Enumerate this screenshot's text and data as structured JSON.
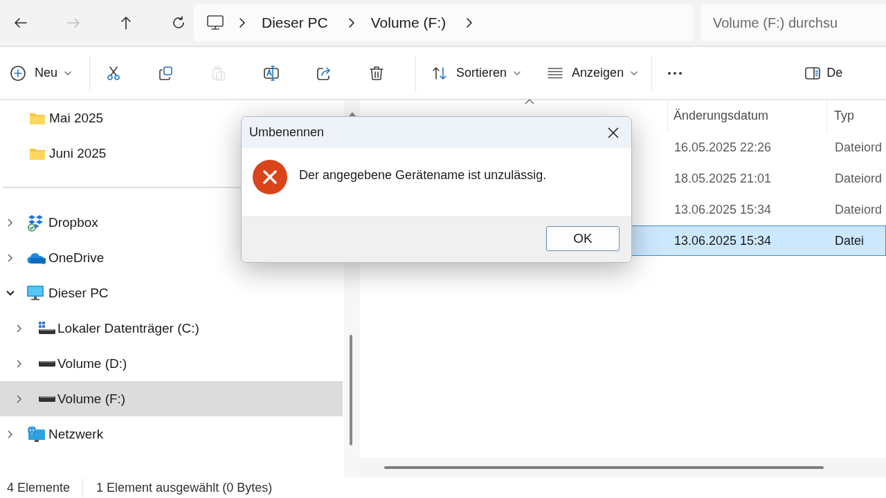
{
  "nav": [
    {
      "kind": "back",
      "disabled": false
    },
    {
      "kind": "forward",
      "disabled": true
    },
    {
      "kind": "up",
      "disabled": false
    },
    {
      "kind": "refresh",
      "disabled": false
    }
  ],
  "address": {
    "segments": [
      "Dieser PC",
      "Volume (F:)"
    ]
  },
  "search": {
    "placeholder": "Volume (F:) durchsu"
  },
  "toolbar": [
    {
      "kind": "new",
      "label": "Neu",
      "dropdown": true,
      "disabled": false
    },
    {
      "kind": "cut",
      "disabled": false
    },
    {
      "kind": "copy",
      "disabled": false
    },
    {
      "kind": "paste",
      "disabled": true
    },
    {
      "kind": "rename",
      "disabled": false
    },
    {
      "kind": "share",
      "disabled": false
    },
    {
      "kind": "delete",
      "disabled": false
    },
    {
      "kind": "sort",
      "label": "Sortieren",
      "dropdown": true,
      "disabled": false
    },
    {
      "kind": "view",
      "label": "Anzeigen",
      "dropdown": true,
      "disabled": false
    },
    {
      "kind": "more",
      "disabled": false
    },
    {
      "kind": "details",
      "label": "De",
      "disabled": false
    }
  ],
  "sidebar": {
    "folders": [
      {
        "label": "Mai 2025",
        "selected": false
      },
      {
        "label": "Juni 2025",
        "selected": false
      }
    ],
    "tree": [
      {
        "kind": "dropbox",
        "label": "Dropbox",
        "expanded": false,
        "selected": false
      },
      {
        "kind": "onedrive",
        "label": "OneDrive",
        "expanded": false,
        "selected": false
      },
      {
        "kind": "pc",
        "label": "Dieser PC",
        "expanded": true,
        "selected": false,
        "children": [
          {
            "kind": "system_drive",
            "label": "Lokaler Datenträger (C:)",
            "expanded": false,
            "selected": false
          },
          {
            "kind": "drive",
            "label": "Volume (D:)",
            "expanded": false,
            "selected": false
          },
          {
            "kind": "drive",
            "label": "Volume (F:)",
            "expanded": false,
            "selected": true
          }
        ]
      },
      {
        "kind": "network",
        "label": "Netzwerk",
        "expanded": false,
        "selected": false
      }
    ]
  },
  "table": {
    "columns": [
      {
        "sorted": true
      },
      {
        "label": "Änderungsdatum",
        "sorted": false
      },
      {
        "label": "Typ",
        "sorted": false
      }
    ],
    "rows": [
      {
        "date": "16.05.2025 22:26",
        "type": "Dateiord",
        "selected": false
      },
      {
        "date": "18.05.2025 21:01",
        "type": "Dateiord",
        "selected": false
      },
      {
        "date": "13.06.2025 15:34",
        "type": "Dateiord",
        "selected": false
      },
      {
        "date": "13.06.2025 15:34",
        "type": "Datei",
        "selected": true
      }
    ]
  },
  "status_bar": {
    "count": "4 Elemente",
    "selection": "1 Element ausgewählt (0 Bytes)"
  },
  "dialog": {
    "title": "Umbenennen",
    "kind": "error",
    "message": "Der angegebene Gerätename ist unzulässig.",
    "buttons": [
      "OK"
    ]
  }
}
